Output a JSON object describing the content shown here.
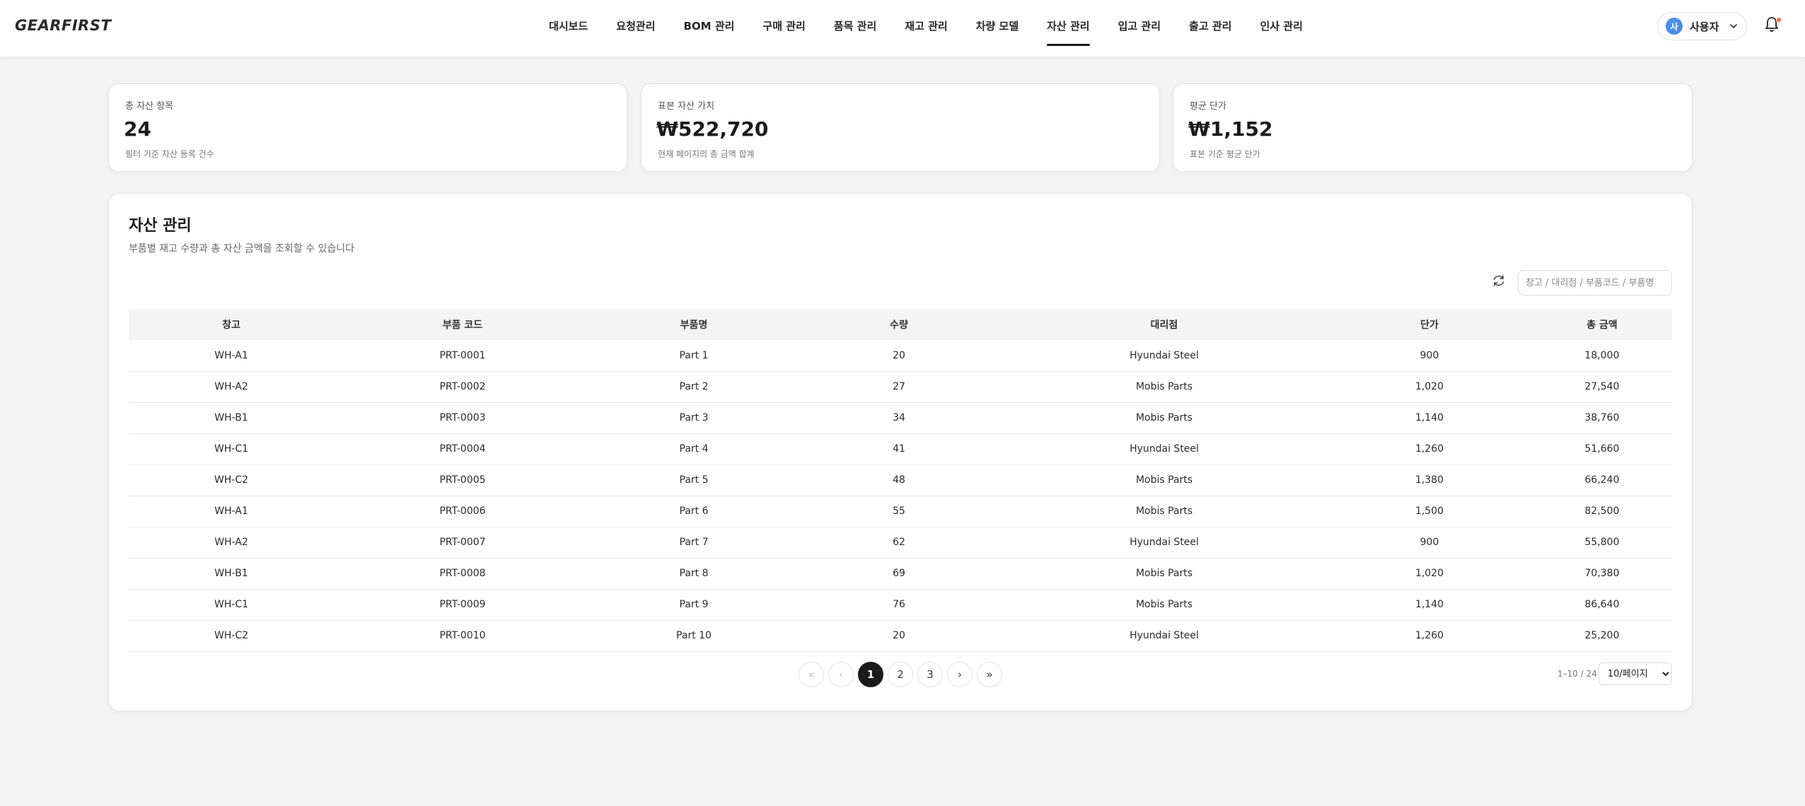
{
  "header": {
    "logo": "GEARFIRST",
    "nav": [
      {
        "label": "대시보드"
      },
      {
        "label": "요청관리"
      },
      {
        "label": "BOM 관리"
      },
      {
        "label": "구매 관리"
      },
      {
        "label": "품목 관리"
      },
      {
        "label": "재고 관리"
      },
      {
        "label": "차량 모델"
      },
      {
        "label": "자산 관리"
      },
      {
        "label": "입고 관리"
      },
      {
        "label": "출고 관리"
      },
      {
        "label": "인사 관리"
      }
    ],
    "active_nav": "자산 관리",
    "user": {
      "avatar_initial": "사",
      "name": "사용자"
    },
    "notification_dot_color": "#ff6a2b"
  },
  "stats": [
    {
      "label": "총 자산 항목",
      "value": "24",
      "sub": "필터 기준 자산 등록 건수"
    },
    {
      "label": "표본 자산 가치",
      "value": "₩522,720",
      "sub": "현재 페이지의 총 금액 합계"
    },
    {
      "label": "평균 단가",
      "value": "₩1,152",
      "sub": "표본 기준 평균 단가"
    }
  ],
  "panel": {
    "title": "자산 관리",
    "description": "부품별 재고 수량과 총 자산 금액을 조회할 수 있습니다",
    "search_placeholder": "창고 / 대리점 / 부품코드 / 부품명"
  },
  "table": {
    "columns": [
      "창고",
      "부품 코드",
      "부품명",
      "수량",
      "대리점",
      "단가",
      "총 금액"
    ],
    "rows": [
      [
        "WH-A1",
        "PRT-0001",
        "Part 1",
        "20",
        "Hyundai Steel",
        "900",
        "18,000"
      ],
      [
        "WH-A2",
        "PRT-0002",
        "Part 2",
        "27",
        "Mobis Parts",
        "1,020",
        "27,540"
      ],
      [
        "WH-B1",
        "PRT-0003",
        "Part 3",
        "34",
        "Mobis Parts",
        "1,140",
        "38,760"
      ],
      [
        "WH-C1",
        "PRT-0004",
        "Part 4",
        "41",
        "Hyundai Steel",
        "1,260",
        "51,660"
      ],
      [
        "WH-C2",
        "PRT-0005",
        "Part 5",
        "48",
        "Mobis Parts",
        "1,380",
        "66,240"
      ],
      [
        "WH-A1",
        "PRT-0006",
        "Part 6",
        "55",
        "Mobis Parts",
        "1,500",
        "82,500"
      ],
      [
        "WH-A2",
        "PRT-0007",
        "Part 7",
        "62",
        "Hyundai Steel",
        "900",
        "55,800"
      ],
      [
        "WH-B1",
        "PRT-0008",
        "Part 8",
        "69",
        "Mobis Parts",
        "1,020",
        "70,380"
      ],
      [
        "WH-C1",
        "PRT-0009",
        "Part 9",
        "76",
        "Mobis Parts",
        "1,140",
        "86,640"
      ],
      [
        "WH-C2",
        "PRT-0010",
        "Part 10",
        "20",
        "Hyundai Steel",
        "1,260",
        "25,200"
      ]
    ]
  },
  "pagination": {
    "first": "«",
    "prev": "‹",
    "pages": [
      "1",
      "2",
      "3"
    ],
    "current": "1",
    "next": "›",
    "last": "»",
    "range_text": "1–10 / 24",
    "page_size": "10/페이지"
  }
}
